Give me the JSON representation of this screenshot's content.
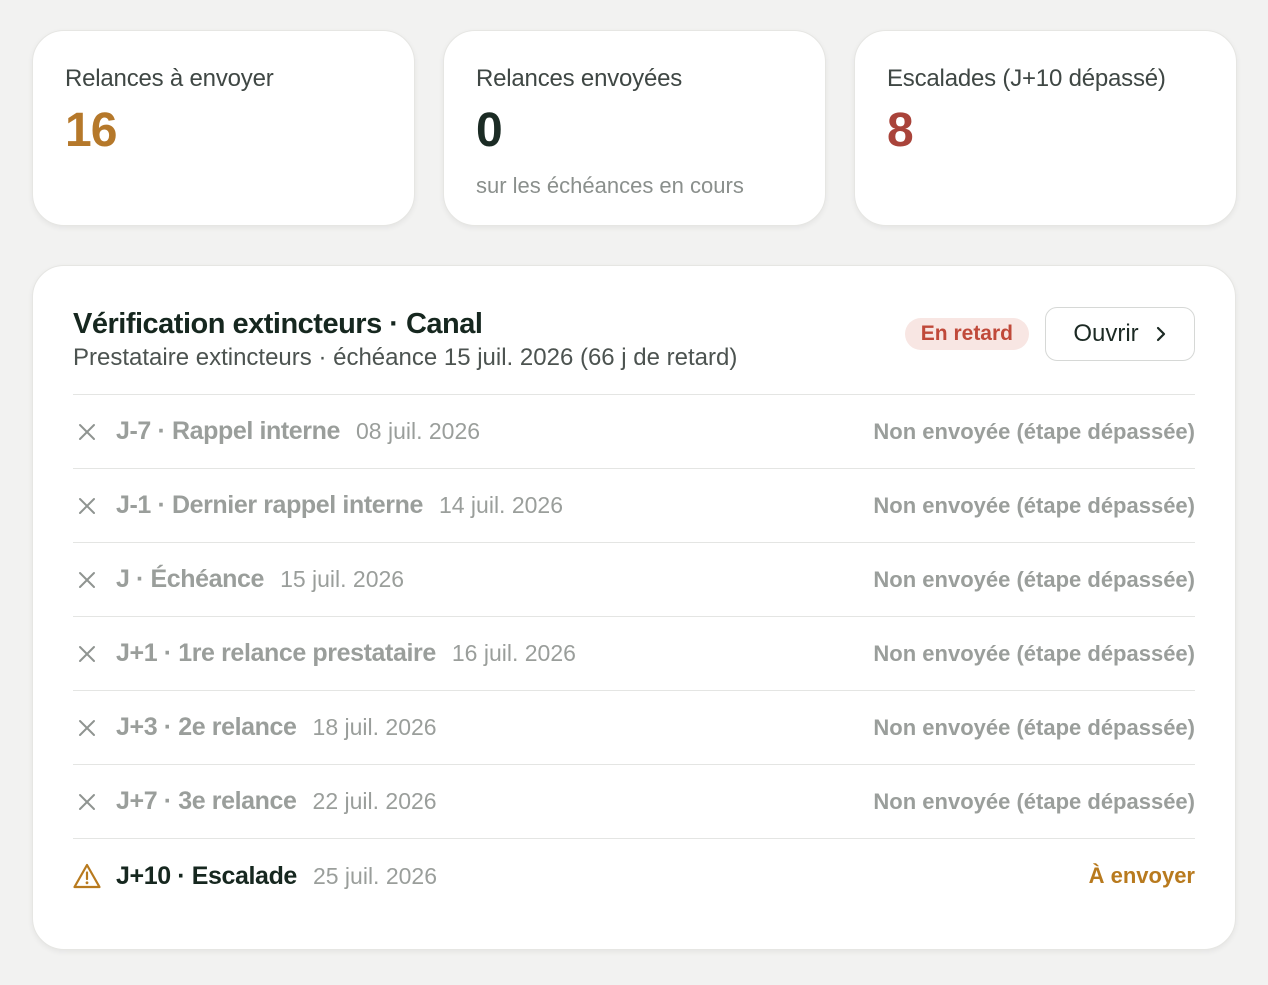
{
  "colors": {
    "to_send": "#b5782a",
    "sent": "#1b2b24",
    "escalations": "#a9433a",
    "badge_bg": "#f8e6e3",
    "badge_text": "#c0493a",
    "pending_status": "#b87a1e"
  },
  "stats": [
    {
      "label": "Relances à envoyer",
      "value": "16",
      "sub": ""
    },
    {
      "label": "Relances envoyées",
      "value": "0",
      "sub": "sur les échéances en cours"
    },
    {
      "label": "Escalades (J+10 dépassé)",
      "value": "8",
      "sub": ""
    }
  ],
  "panel": {
    "title": "Vérification extincteurs · Canal",
    "subtitle": "Prestataire extincteurs · échéance 15 juil. 2026 (66 j de retard)",
    "badge": "En retard",
    "open_label": "Ouvrir",
    "open_icon": "chevron-right-icon"
  },
  "rows": [
    {
      "icon": "close-icon",
      "title": "J-7 · Rappel interne",
      "date": "08 juil. 2026",
      "status": "Non envoyée (étape dépassée)"
    },
    {
      "icon": "close-icon",
      "title": "J-1 · Dernier rappel interne",
      "date": "14 juil. 2026",
      "status": "Non envoyée (étape dépassée)"
    },
    {
      "icon": "close-icon",
      "title": "J · Échéance",
      "date": "15 juil. 2026",
      "status": "Non envoyée (étape dépassée)"
    },
    {
      "icon": "close-icon",
      "title": "J+1 · 1re relance prestataire",
      "date": "16 juil. 2026",
      "status": "Non envoyée (étape dépassée)"
    },
    {
      "icon": "close-icon",
      "title": "J+3 · 2e relance",
      "date": "18 juil. 2026",
      "status": "Non envoyée (étape dépassée)"
    },
    {
      "icon": "close-icon",
      "title": "J+7 · 3e relance",
      "date": "22 juil. 2026",
      "status": "Non envoyée (étape dépassée)"
    },
    {
      "icon": "warning-icon",
      "title": "J+10 · Escalade",
      "date": "25 juil. 2026",
      "status": "À envoyer"
    }
  ]
}
